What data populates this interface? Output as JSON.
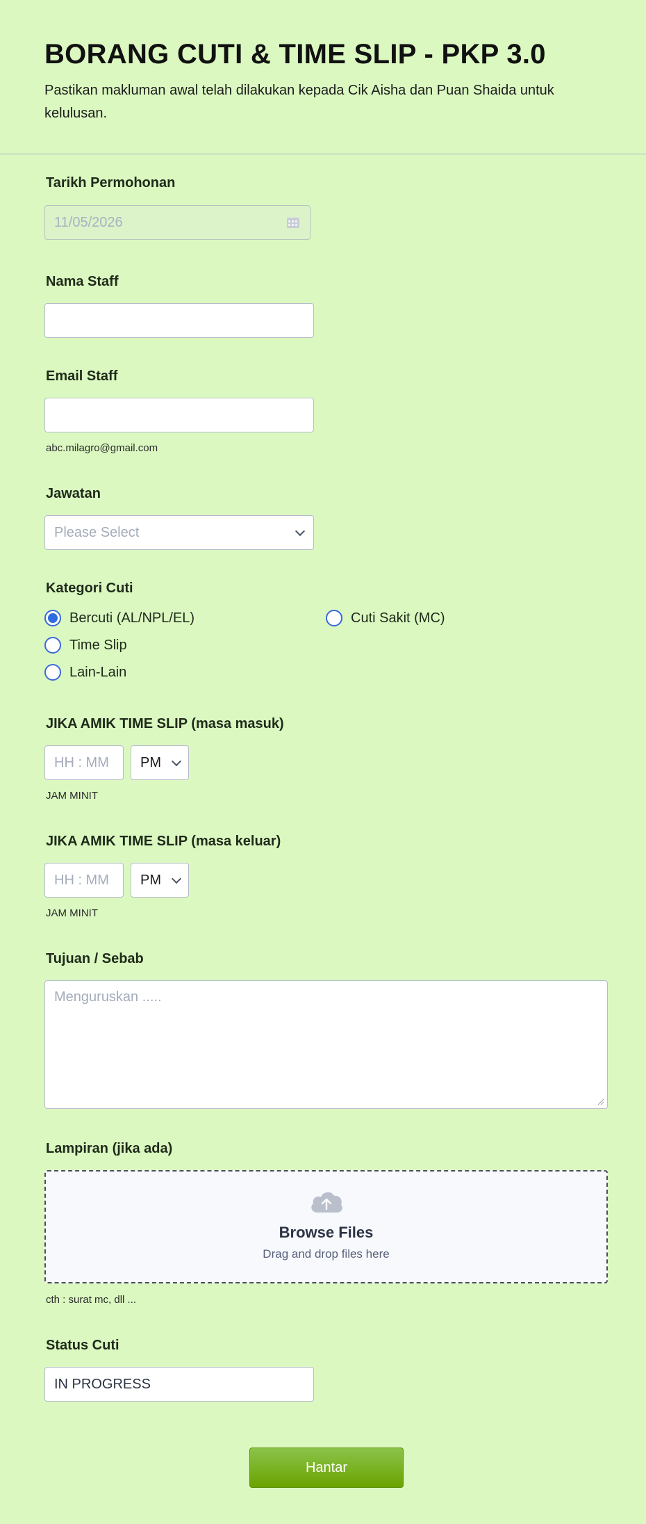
{
  "header": {
    "title": "BORANG CUTI & TIME SLIP - PKP 3.0",
    "subtitle": "Pastikan makluman awal telah dilakukan kepada Cik Aisha dan Puan Shaida untuk kelulusan."
  },
  "tarikh": {
    "label": "Tarikh Permohonan",
    "value": "11/05/2026",
    "icon": "calendar-icon"
  },
  "nama": {
    "label": "Nama Staff",
    "value": ""
  },
  "email": {
    "label": "Email Staff",
    "value": "",
    "sublabel": "abc.milagro@gmail.com"
  },
  "jawatan": {
    "label": "Jawatan",
    "placeholder": "Please Select",
    "icon": "chevron-down-icon"
  },
  "kategori": {
    "label": "Kategori Cuti",
    "options": [
      "Bercuti (AL/NPL/EL)",
      "Cuti Sakit (MC)",
      "Time Slip",
      "Lain-Lain"
    ],
    "selected": "Bercuti (AL/NPL/EL)"
  },
  "masuk": {
    "label": "JIKA AMIK TIME SLIP (masa masuk)",
    "placeholder": "HH : MM",
    "ampm": "PM",
    "sublabel": "JAM MINIT"
  },
  "keluar": {
    "label": "JIKA AMIK TIME SLIP (masa keluar)",
    "placeholder": "HH : MM",
    "ampm": "PM",
    "sublabel": "JAM MINIT"
  },
  "tujuan": {
    "label": "Tujuan / Sebab",
    "placeholder": "Menguruskan ....."
  },
  "lampiran": {
    "label": "Lampiran (jika ada)",
    "browse": "Browse Files",
    "drag": "Drag and drop files here",
    "sublabel": "cth : surat mc, dll ...",
    "icon": "upload-cloud-icon"
  },
  "status": {
    "label": "Status Cuti",
    "value": "IN PROGRESS"
  },
  "submit": {
    "label": "Hantar"
  },
  "colors": {
    "background": "#dbf8c1",
    "accent": "#2f6be0",
    "submit": "#7ab51d"
  }
}
